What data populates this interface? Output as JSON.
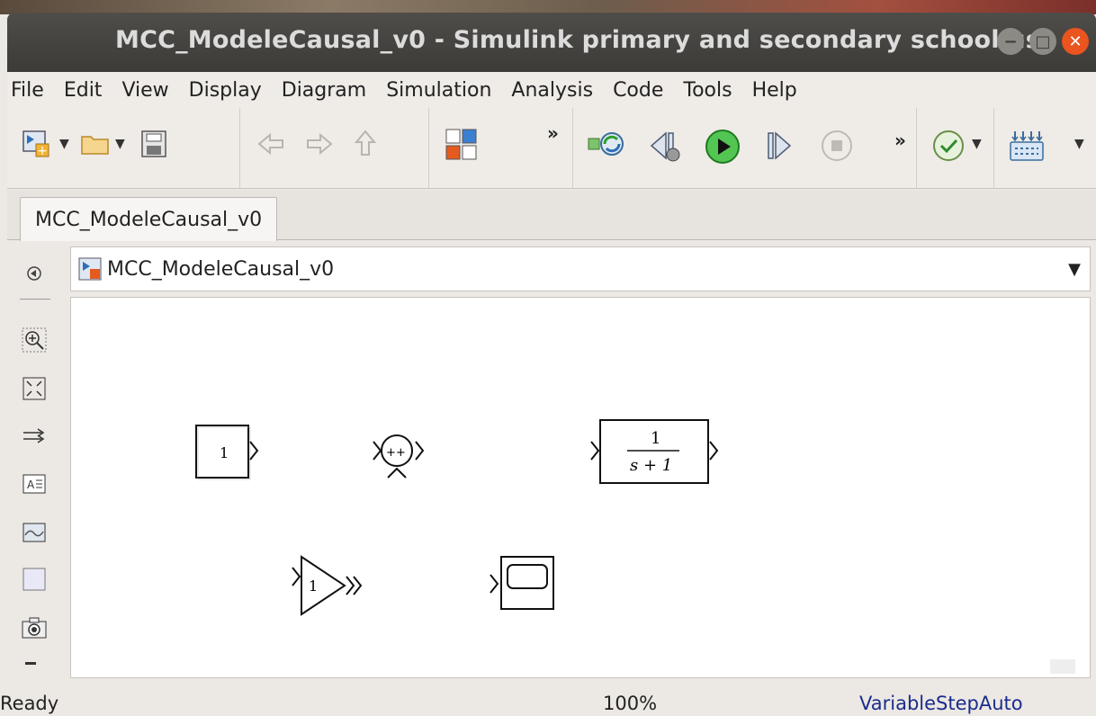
{
  "window": {
    "title": "MCC_ModeleCausal_v0 - Simulink primary and secondary school use",
    "minimize_icon": "minimize-icon",
    "maximize_icon": "maximize-icon",
    "close_icon": "close-icon"
  },
  "menu": [
    "File",
    "Edit",
    "View",
    "Display",
    "Diagram",
    "Simulation",
    "Analysis",
    "Code",
    "Tools",
    "Help"
  ],
  "toolbar": {
    "more_label_1": "»",
    "more_label_2": "»"
  },
  "tab": {
    "label": "MCC_ModeleCausal_v0"
  },
  "address": {
    "path": "MCC_ModeleCausal_v0"
  },
  "blocks": {
    "constant_value": "1",
    "transfer_numerator": "1",
    "transfer_denominator": "s + 1",
    "gain_value": "1",
    "sum_signs": "++"
  },
  "status": {
    "state": "Ready",
    "zoom": "100%",
    "solver": "VariableStepAuto"
  },
  "colors": {
    "titlebar": "#3c3b38",
    "close_button": "#e9541f",
    "run_button": "#2aa02a",
    "solver_text": "#1a2c8c"
  }
}
